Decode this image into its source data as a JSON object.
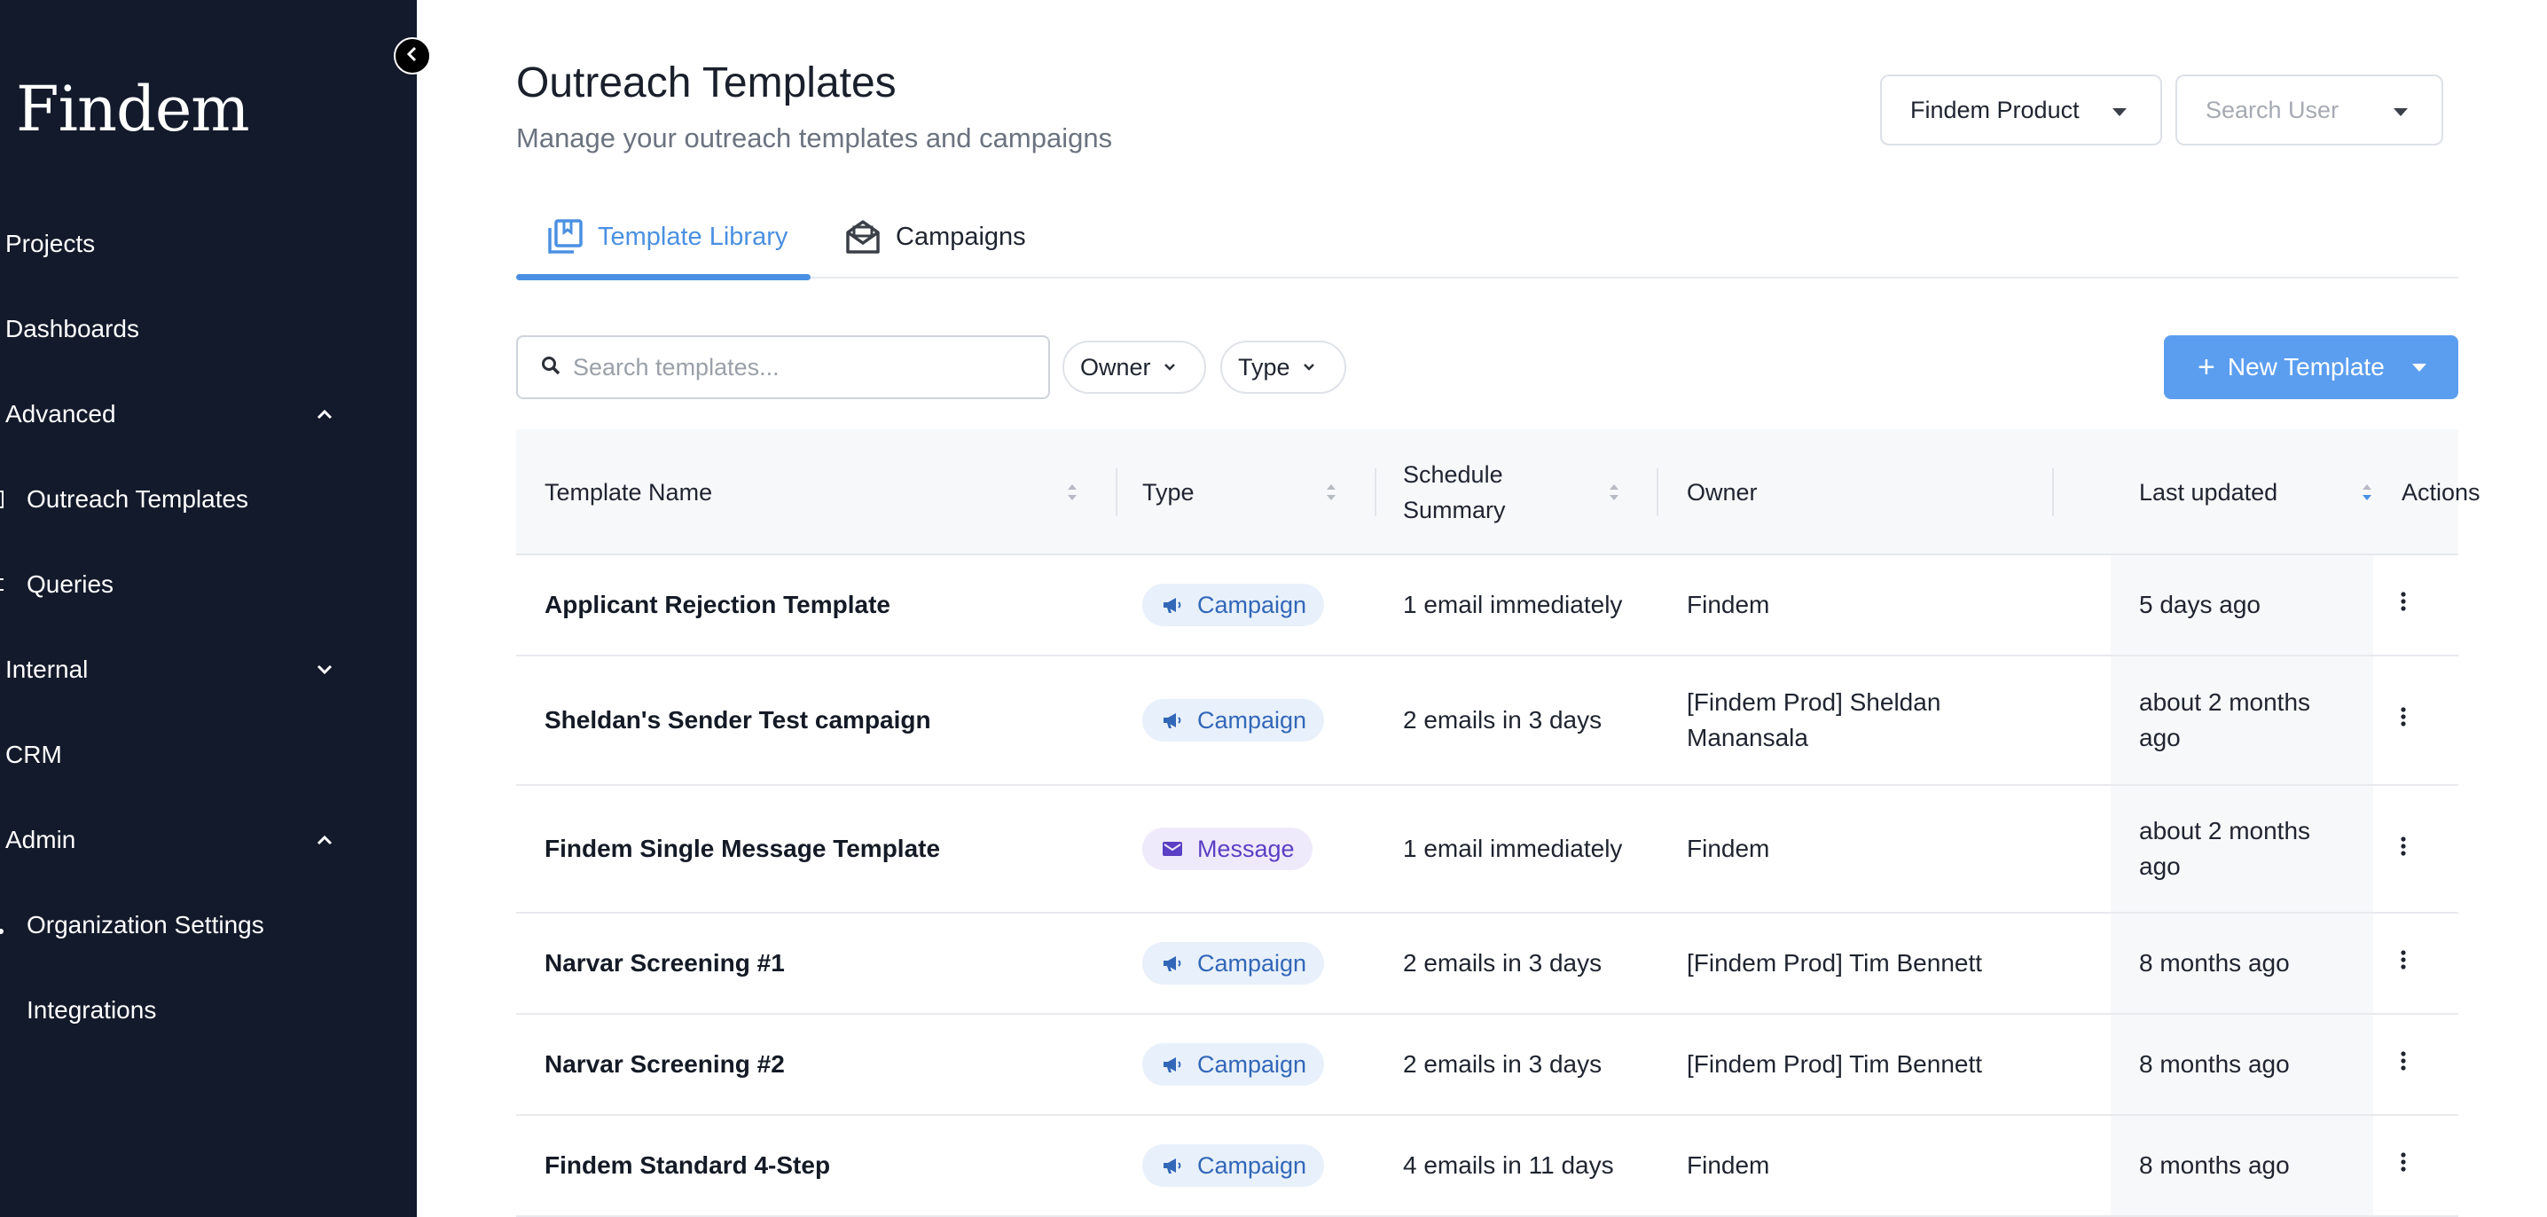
{
  "sidebar": {
    "logo": "Findem",
    "items": [
      {
        "label": "Projects"
      },
      {
        "label": "Dashboards"
      },
      {
        "label": "Advanced"
      },
      {
        "label": "Outreach Templates"
      },
      {
        "label": "Queries"
      },
      {
        "label": "Internal"
      },
      {
        "label": "CRM"
      },
      {
        "label": "Admin"
      },
      {
        "label": "Organization Settings"
      },
      {
        "label": "Integrations"
      }
    ]
  },
  "header": {
    "title": "Outreach Templates",
    "subtitle": "Manage your outreach templates and campaigns",
    "org_select": "Findem Product",
    "user_select_placeholder": "Search User"
  },
  "tabs": [
    {
      "label": "Template Library",
      "active": true
    },
    {
      "label": "Campaigns",
      "active": false
    }
  ],
  "toolbar": {
    "search_placeholder": "Search templates...",
    "filter_owner": "Owner",
    "filter_type": "Type",
    "new_template_label": "New Template"
  },
  "table": {
    "columns": {
      "name": "Template Name",
      "type": "Type",
      "schedule": "Schedule Summary",
      "owner": "Owner",
      "updated": "Last updated",
      "actions": "Actions"
    },
    "rows": [
      {
        "name": "Applicant Rejection Template",
        "type": "Campaign",
        "schedule": "1 email immediately",
        "owner": "Findem",
        "updated": "5 days ago"
      },
      {
        "name": "Sheldan's Sender Test campaign",
        "type": "Campaign",
        "schedule": "2 emails in 3 days",
        "owner": "[Findem Prod] Sheldan Manansala",
        "updated": "about 2 months ago"
      },
      {
        "name": "Findem Single Message Template",
        "type": "Message",
        "schedule": "1 email immediately",
        "owner": "Findem",
        "updated": "about 2 months ago"
      },
      {
        "name": "Narvar Screening #1",
        "type": "Campaign",
        "schedule": "2 emails in 3 days",
        "owner": "[Findem Prod] Tim Bennett",
        "updated": "8 months ago"
      },
      {
        "name": "Narvar Screening #2",
        "type": "Campaign",
        "schedule": "2 emails in 3 days",
        "owner": "[Findem Prod] Tim Bennett",
        "updated": "8 months ago"
      },
      {
        "name": "Findem Standard 4-Step",
        "type": "Campaign",
        "schedule": "4 emails in 11 days",
        "owner": "Findem",
        "updated": "8 months ago"
      }
    ]
  },
  "colors": {
    "sidebar_bg": "#121a2b",
    "accent": "#4a90e2",
    "campaign_badge_bg": "#e8f0fb",
    "campaign_badge_text": "#3267b8",
    "message_badge_bg": "#efeafb",
    "message_badge_text": "#5b3fc4"
  }
}
